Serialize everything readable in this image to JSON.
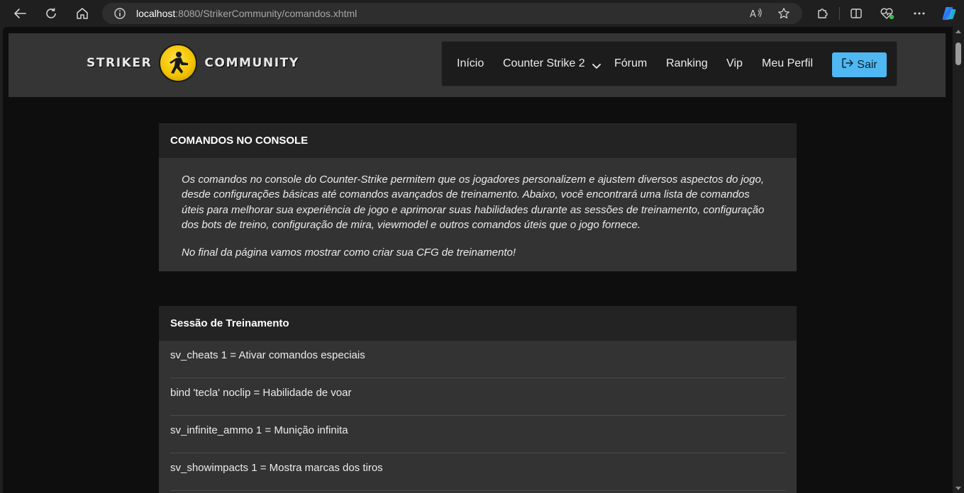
{
  "browser": {
    "url_host": "localhost",
    "url_rest": ":8080/StrikerCommunity/comandos.xhtml"
  },
  "site": {
    "logo_left": "STRIKER",
    "logo_right": "COMMUNITY",
    "nav": {
      "inicio": "Início",
      "counter_strike": "Counter Strike 2",
      "forum": "Fórum",
      "ranking": "Ranking",
      "vip": "Vip",
      "perfil": "Meu Perfil",
      "sair": "Sair"
    }
  },
  "intro_card": {
    "title": "COMANDOS NO CONSOLE",
    "paragraph1": "Os comandos no console do Counter-Strike permitem que os jogadores personalizem e ajustem diversos aspectos do jogo, desde configurações básicas até comandos avançados de treinamento. Abaixo, você encontrará uma lista de comandos úteis para melhorar sua experiência de jogo e aprimorar suas habilidades durante as sessões de treinamento, configuração dos bots de treino, configuração de mira, viewmodel e outros comandos úteis que o jogo fornece.",
    "paragraph2": "No final da página vamos mostrar como criar sua CFG de treinamento!"
  },
  "training_card": {
    "title": "Sessão de Treinamento",
    "commands": [
      "sv_cheats 1 = Ativar comandos especiais",
      "bind 'tecla' noclip = Habilidade de voar",
      "sv_infinite_ammo 1 = Munição infinita",
      "sv_showimpacts 1 = Mostra marcas dos tiros"
    ]
  },
  "icons": [
    "back-icon",
    "refresh-icon",
    "home-icon",
    "info-icon",
    "read-aloud-icon",
    "favorite-icon",
    "extensions-icon",
    "split-screen-icon",
    "browser-essentials-icon",
    "more-icon",
    "copilot-icon",
    "chevron-down-icon",
    "sign-out-icon"
  ],
  "colors": {
    "accent": "#4fb8f2",
    "header_bg": "#353535",
    "page_bg": "#0e0e0e",
    "card_bg": "#333333",
    "card_header_bg": "#232323"
  }
}
